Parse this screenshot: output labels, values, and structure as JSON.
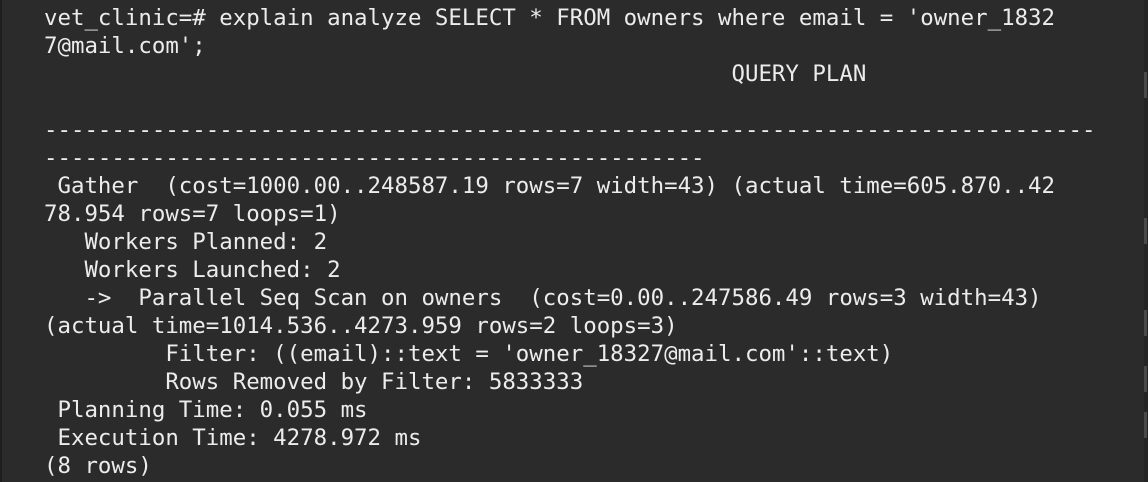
{
  "terminal": {
    "lines": [
      "vet_clinic=# explain analyze SELECT * FROM owners where email = 'owner_1832",
      "7@mail.com';",
      "                                                   QUERY PLAN",
      "",
      "------------------------------------------------------------------------------",
      "-------------------------------------------------",
      " Gather  (cost=1000.00..248587.19 rows=7 width=43) (actual time=605.870..42",
      "78.954 rows=7 loops=1)",
      "   Workers Planned: 2",
      "   Workers Launched: 2",
      "   ->  Parallel Seq Scan on owners  (cost=0.00..247586.49 rows=3 width=43)",
      "(actual time=1014.536..4273.959 rows=2 loops=3)",
      "         Filter: ((email)::text = 'owner_18327@mail.com'::text)",
      "         Rows Removed by Filter: 5833333",
      " Planning Time: 0.055 ms",
      " Execution Time: 4278.972 ms",
      "(8 rows)"
    ]
  }
}
